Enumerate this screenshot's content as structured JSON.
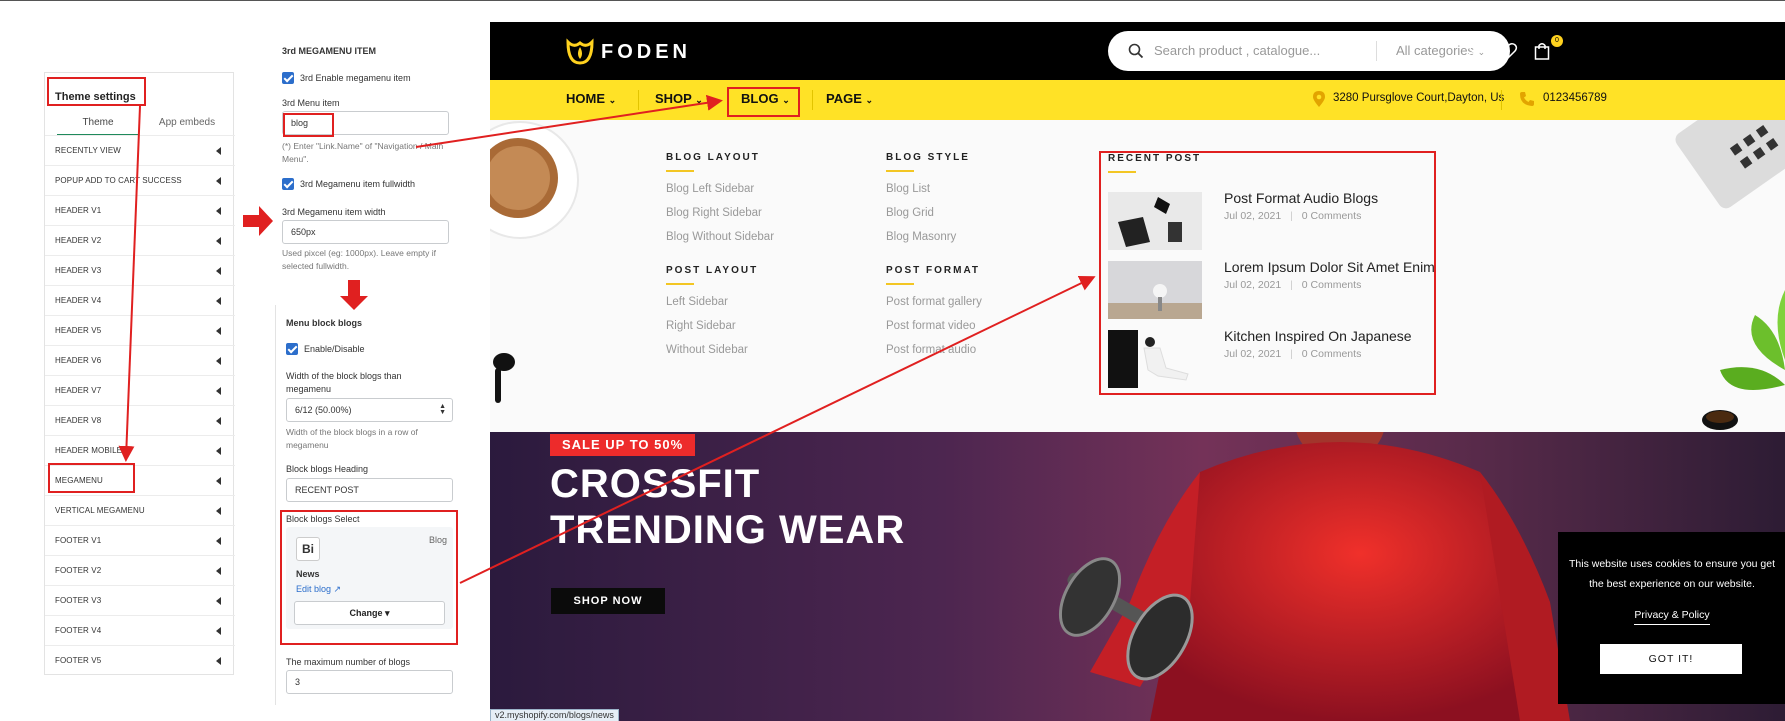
{
  "sidebar": {
    "title": "Theme settings",
    "tabs": [
      "Theme",
      "App embeds"
    ],
    "items": [
      "RECENTLY VIEW",
      "POPUP ADD TO CART SUCCESS",
      "HEADER V1",
      "HEADER V2",
      "HEADER V3",
      "HEADER V4",
      "HEADER V5",
      "HEADER V6",
      "HEADER V7",
      "HEADER V8",
      "HEADER MOBILE",
      "MEGAMENU",
      "VERTICAL MEGAMENU",
      "FOOTER V1",
      "FOOTER V2",
      "FOOTER V3",
      "FOOTER V4",
      "FOOTER V5"
    ]
  },
  "settings": {
    "section_title": "3rd MEGAMENU ITEM",
    "enable_label": "3rd Enable megamenu item",
    "menu_item_label": "3rd Menu item",
    "menu_item_value": "blog",
    "menu_item_help": "(*) Enter \"Link.Name\" of \"Navigation / Main Menu\".",
    "fullwidth_label": "3rd Megamenu item fullwidth",
    "width_label": "3rd Megamenu item width",
    "width_value": "650px",
    "width_help": "Used pixcel (eg: 1000px). Leave empty if selected fullwidth.",
    "block_title": "Menu block blogs",
    "enable_disable_label": "Enable/Disable",
    "block_width_label": "Width of the block blogs than megamenu",
    "block_width_value": "6/12 (50.00%)",
    "block_width_help": "Width of the block blogs in a row of megamenu",
    "heading_label": "Block blogs Heading",
    "heading_value": "RECENT POST",
    "select_label": "Block blogs Select",
    "blog_type": "Blog",
    "blog_icon": "Bi",
    "blog_name": "News",
    "edit_blog": "Edit blog",
    "change_label": "Change",
    "max_label": "The maximum number of blogs",
    "max_value": "3"
  },
  "store": {
    "logo_text": "FODEN",
    "search_placeholder": "Search product , catalogue...",
    "category_label": "All categories",
    "cart_count": "0",
    "nav": [
      "HOME",
      "SHOP",
      "BLOG",
      "PAGE"
    ],
    "address": "3280 Pursglove Court,Dayton, Us",
    "phone": "0123456789",
    "mega": {
      "blog_layout": {
        "title": "BLOG LAYOUT",
        "links": [
          "Blog Left Sidebar",
          "Blog Right Sidebar",
          "Blog Without Sidebar"
        ]
      },
      "post_layout": {
        "title": "POST LAYOUT",
        "links": [
          "Left Sidebar",
          "Right Sidebar",
          "Without Sidebar"
        ]
      },
      "blog_style": {
        "title": "BLOG STYLE",
        "links": [
          "Blog List",
          "Blog Grid",
          "Blog Masonry"
        ]
      },
      "post_format": {
        "title": "POST FORMAT",
        "links": [
          "Post format gallery",
          "Post format video",
          "Post format audio"
        ]
      },
      "recent_post": {
        "title": "RECENT POST",
        "posts": [
          {
            "title": "Post Format Audio Blogs",
            "date": "Jul 02, 2021",
            "comments": "0 Comments"
          },
          {
            "title": "Lorem Ipsum Dolor Sit Amet Enim",
            "date": "Jul 02, 2021",
            "comments": "0 Comments"
          },
          {
            "title": "Kitchen Inspired On Japanese",
            "date": "Jul 02, 2021",
            "comments": "0 Comments"
          }
        ]
      }
    },
    "hero": {
      "badge": "SALE UP TO 50%",
      "line1": "CROSSFIT",
      "line2": "TRENDING WEAR",
      "cta": "SHOP NOW"
    },
    "cookie": {
      "message": "This website uses cookies to ensure you get the best experience on our website.",
      "link": "Privacy & Policy",
      "button": "GOT IT!"
    },
    "status_url": "v2.myshopify.com/blogs/news"
  },
  "colors": {
    "accent_yellow": "#ffe226",
    "annotation_red": "#e02020",
    "sale_red": "#ed2b2b",
    "toggle_blue": "#2c6ecb"
  }
}
